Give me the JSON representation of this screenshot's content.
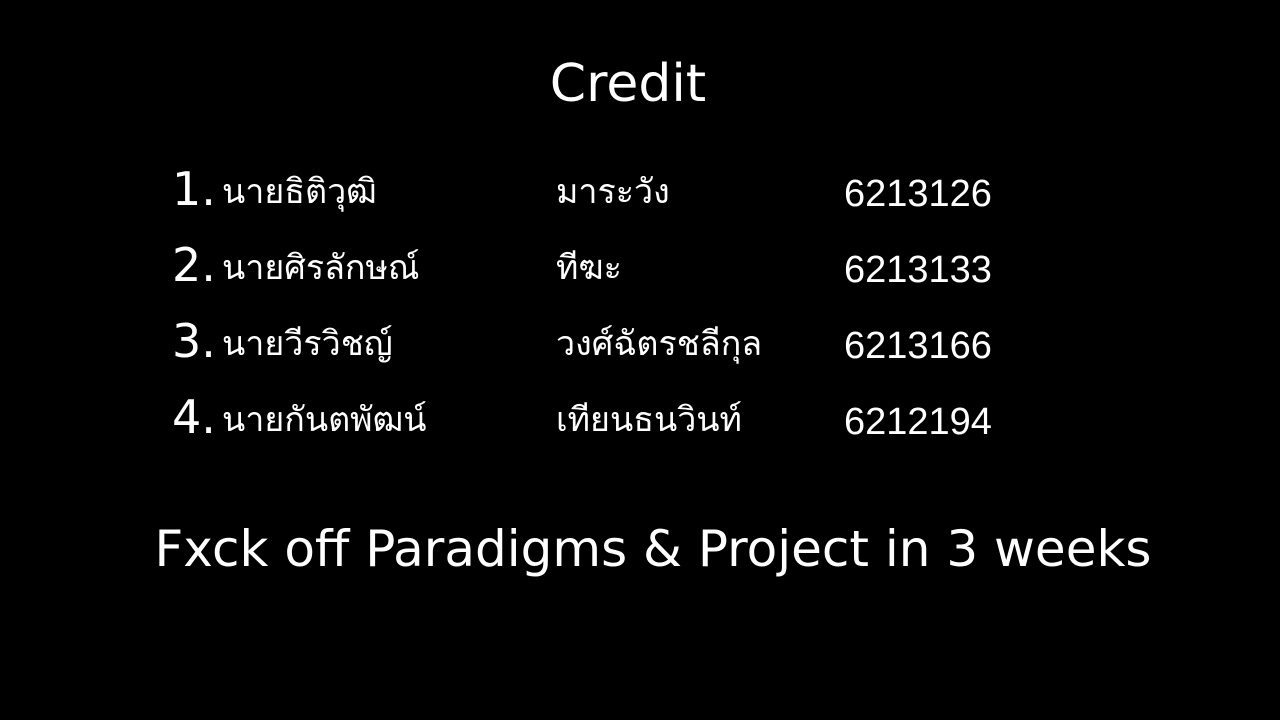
{
  "slide": {
    "title": "Credit",
    "credits": [
      {
        "number": "1.",
        "first_name": "นายธิติวุฒิ",
        "last_name": "มาระวัง",
        "student_id": "6213126"
      },
      {
        "number": "2.",
        "first_name": "นายศิรลักษณ์",
        "last_name": "ทีฆะ",
        "student_id": "6213133"
      },
      {
        "number": "3.",
        "first_name": "นายวีรวิชญ์",
        "last_name": "วงศ์ฉัตรชลีกุล",
        "student_id": "6213166"
      },
      {
        "number": "4.",
        "first_name": "นายกันตพัฒน์",
        "last_name": "เทียนธนวินท์",
        "student_id": "6212194"
      }
    ],
    "footer": "Fxck off Paradigms & Project in 3 weeks",
    "colors": {
      "background": "#000000",
      "text": "#ffffff"
    }
  }
}
